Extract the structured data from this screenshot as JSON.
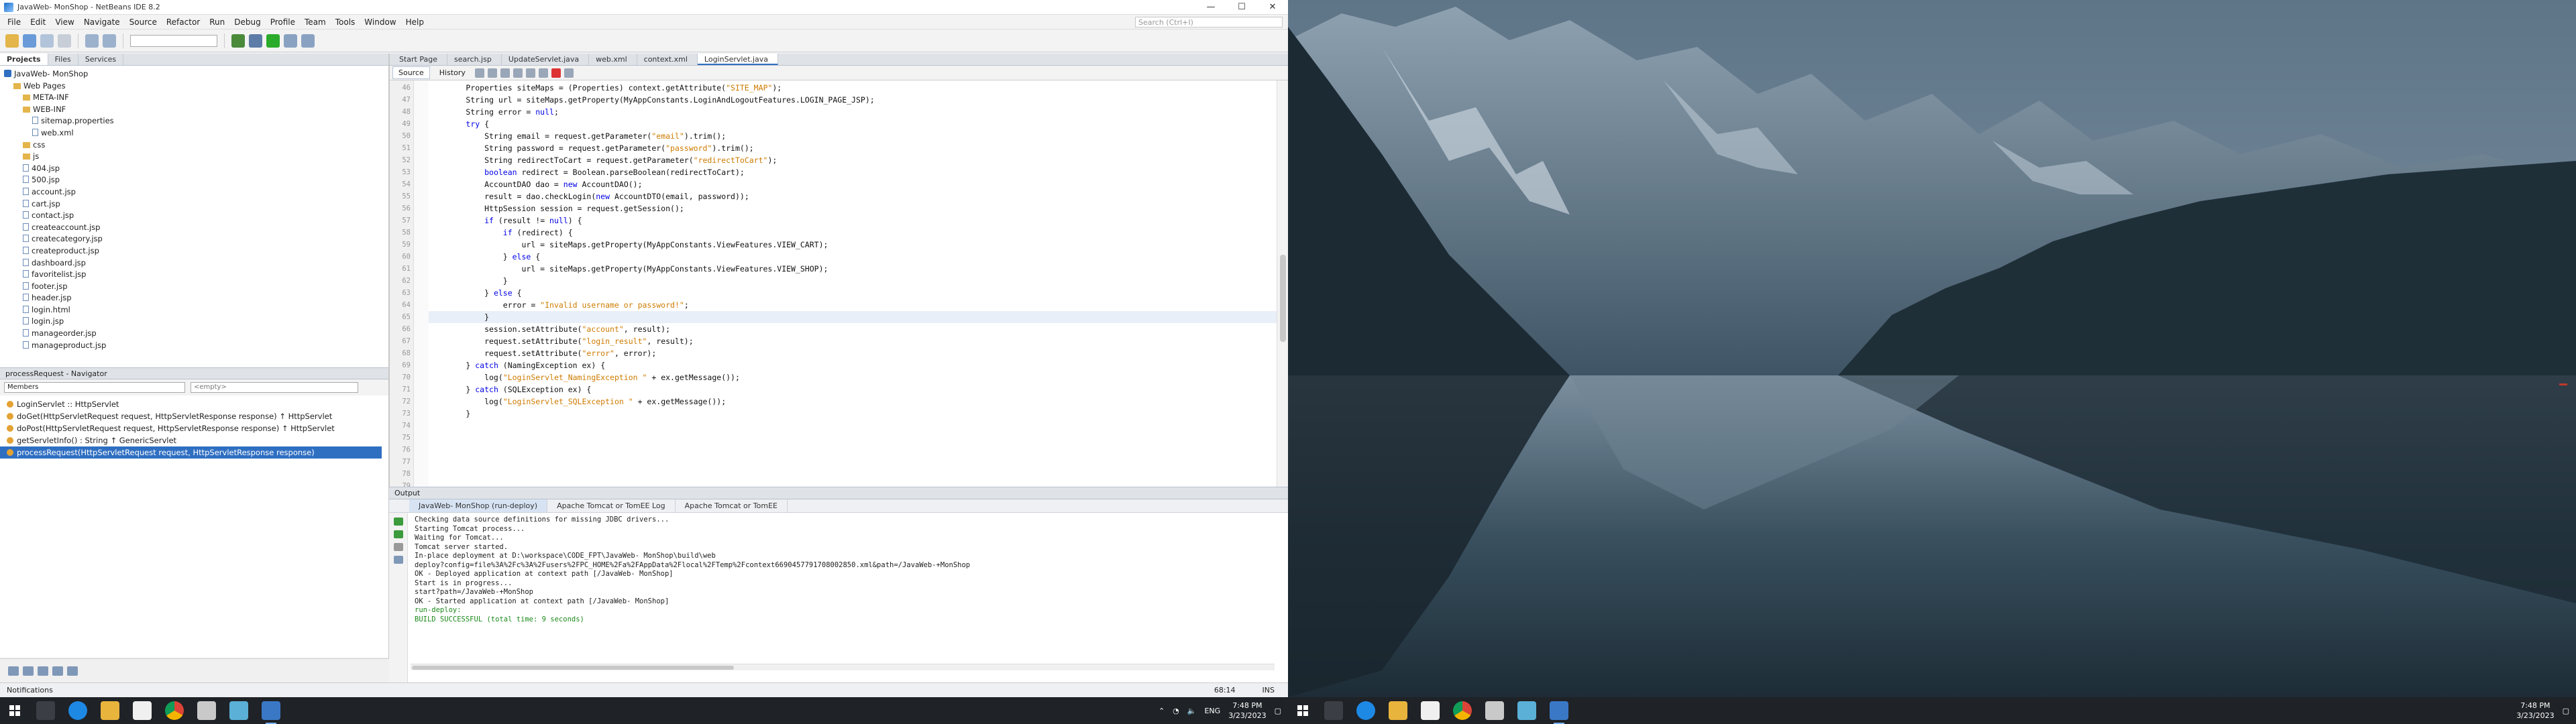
{
  "ide": {
    "window_title": "JavaWeb- MonShop - NetBeans IDE 8.2",
    "menu": [
      "File",
      "Edit",
      "View",
      "Navigate",
      "Source",
      "Refactor",
      "Run",
      "Debug",
      "Profile",
      "Team",
      "Tools",
      "Window",
      "Help"
    ],
    "search_placeholder": "Search (Ctrl+I)",
    "project_tabs": [
      "Projects",
      "Files",
      "Services"
    ],
    "tree": [
      {
        "label": "JavaWeb- MonShop",
        "icon": "project-icon",
        "indent": 0
      },
      {
        "label": "Web Pages",
        "icon": "folder-icon",
        "indent": 1
      },
      {
        "label": "META-INF",
        "icon": "folder-icon",
        "indent": 2
      },
      {
        "label": "WEB-INF",
        "icon": "folder-icon",
        "indent": 2
      },
      {
        "label": "sitemap.properties",
        "icon": "file-icon",
        "indent": 3
      },
      {
        "label": "web.xml",
        "icon": "file-icon",
        "indent": 3
      },
      {
        "label": "css",
        "icon": "folder-icon",
        "indent": 2
      },
      {
        "label": "js",
        "icon": "folder-icon",
        "indent": 2
      },
      {
        "label": "404.jsp",
        "icon": "file-icon",
        "indent": 2
      },
      {
        "label": "500.jsp",
        "icon": "file-icon",
        "indent": 2
      },
      {
        "label": "account.jsp",
        "icon": "file-icon",
        "indent": 2
      },
      {
        "label": "cart.jsp",
        "icon": "file-icon",
        "indent": 2
      },
      {
        "label": "contact.jsp",
        "icon": "file-icon",
        "indent": 2
      },
      {
        "label": "createaccount.jsp",
        "icon": "file-icon",
        "indent": 2
      },
      {
        "label": "createcategory.jsp",
        "icon": "file-icon",
        "indent": 2
      },
      {
        "label": "createproduct.jsp",
        "icon": "file-icon",
        "indent": 2
      },
      {
        "label": "dashboard.jsp",
        "icon": "file-icon",
        "indent": 2
      },
      {
        "label": "favoritelist.jsp",
        "icon": "file-icon",
        "indent": 2
      },
      {
        "label": "footer.jsp",
        "icon": "file-icon",
        "indent": 2
      },
      {
        "label": "header.jsp",
        "icon": "file-icon",
        "indent": 2
      },
      {
        "label": "login.html",
        "icon": "file-icon",
        "indent": 2
      },
      {
        "label": "login.jsp",
        "icon": "file-icon",
        "indent": 2
      },
      {
        "label": "manageorder.jsp",
        "icon": "file-icon",
        "indent": 2
      },
      {
        "label": "manageproduct.jsp",
        "icon": "file-icon",
        "indent": 2
      }
    ],
    "navigator": {
      "title": "processRequest - Navigator",
      "filter": "Members",
      "filter2": "<empty>",
      "items": [
        {
          "label": "LoginServlet :: HttpServlet",
          "selected": false
        },
        {
          "label": "doGet(HttpServletRequest request, HttpServletResponse response) ↑ HttpServlet",
          "selected": false
        },
        {
          "label": "doPost(HttpServletRequest request, HttpServletResponse response) ↑ HttpServlet",
          "selected": false
        },
        {
          "label": "getServletInfo() : String ↑ GenericServlet",
          "selected": false
        },
        {
          "label": "processRequest(HttpServletRequest request, HttpServletResponse response)",
          "selected": true
        }
      ]
    },
    "editor_tabs": [
      "Start Page",
      "search.jsp",
      "UpdateServlet.java",
      "web.xml",
      "context.xml",
      "LoginServlet.java"
    ],
    "active_tab": "LoginServlet.java",
    "source_label": "Source",
    "history_label": "History",
    "line_numbers": [
      "46",
      "47",
      "48",
      "49",
      "50",
      "51",
      "52",
      "53",
      "54",
      "55",
      "56",
      "57",
      "58",
      "59",
      "60",
      "61",
      "62",
      "63",
      "64",
      "65",
      "66",
      "67",
      "68",
      "69",
      "70",
      "71",
      "72",
      "73",
      "74",
      "75",
      "76",
      "77",
      "78",
      "79"
    ],
    "code_lines": [
      "        Properties siteMaps = (Properties) context.getAttribute(\"SITE_MAP\");",
      "        String url = siteMaps.getProperty(MyAppConstants.LoginAndLogoutFeatures.LOGIN_PAGE_JSP);",
      "        String error = null;",
      "        try {",
      "",
      "            String email = request.getParameter(\"email\").trim();",
      "            String password = request.getParameter(\"password\").trim();",
      "            String redirectToCart = request.getParameter(\"redirectToCart\");",
      "            boolean redirect = Boolean.parseBoolean(redirectToCart);",
      "            AccountDAO dao = new AccountDAO();",
      "            result = dao.checkLogin(new AccountDTO(email, password));",
      "            HttpSession session = request.getSession();",
      "",
      "            if (result != null) {",
      "                if (redirect) {",
      "                    url = siteMaps.getProperty(MyAppConstants.ViewFeatures.VIEW_CART);",
      "                } else {",
      "                    url = siteMaps.getProperty(MyAppConstants.ViewFeatures.VIEW_SHOP);",
      "                }",
      "",
      "            } else {",
      "                error = \"Invalid username or password!\";",
      "            }",
      "",
      "            session.setAttribute(\"account\", result);",
      "",
      "            request.setAttribute(\"login_result\", result);",
      "            request.setAttribute(\"error\", error);",
      "",
      "        } catch (NamingException ex) {",
      "            log(\"LoginServlet_NamingException \" + ex.getMessage());",
      "        } catch (SQLException ex) {",
      "            log(\"LoginServlet_SQLException \" + ex.getMessage());",
      "        }"
    ],
    "output": {
      "title": "Output",
      "tabs": [
        "JavaWeb- MonShop (run-deploy)",
        "Apache Tomcat or TomEE Log",
        "Apache Tomcat or TomEE"
      ],
      "lines": [
        "Checking data source definitions for missing JDBC drivers...",
        "Starting Tomcat process...",
        "Waiting for Tomcat...",
        "Tomcat server started.",
        "In-place deployment at D:\\workspace\\CODE_FPT\\JavaWeb- MonShop\\build\\web",
        "deploy?config=file%3A%2Fc%3A%2Fusers%2FPC_HOME%2Fa%2FAppData%2Flocal%2FTemp%2Fcontext6690457791708002850.xml&path=/JavaWeb-+MonShop",
        "OK - Deployed application at context path [/JavaWeb- MonShop]",
        "Start is in progress...",
        "start?path=/JavaWeb-+MonShop",
        "OK - Started application at context path [/JavaWeb- MonShop]",
        "run-deploy:",
        "BUILD SUCCESSFUL (total time: 9 seconds)"
      ]
    },
    "status": {
      "position": "68:14",
      "mode": "INS"
    },
    "notifications": "Notifications"
  },
  "taskbar": {
    "time": "7:48 PM",
    "date": "3/23/2023",
    "lang": "ENG"
  },
  "colors": {
    "accent": "#2f6fc2",
    "string": "#ce7b00",
    "keyword": "#0000e6",
    "success": "#1c8b1c"
  }
}
